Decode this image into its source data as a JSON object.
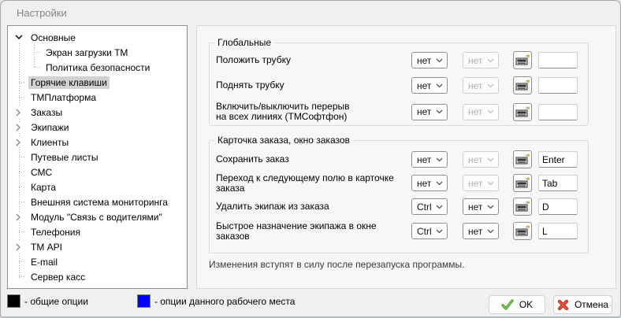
{
  "window": {
    "title": "Настройки",
    "bg_color": "#f0f0f0"
  },
  "tree": {
    "items": [
      {
        "label": "Основные",
        "level": 0,
        "state": "expanded",
        "selected": false
      },
      {
        "label": "Экран загрузки ТМ",
        "level": 1,
        "state": "leaf",
        "selected": false
      },
      {
        "label": "Политика безопасности",
        "level": 1,
        "state": "leaf",
        "selected": false
      },
      {
        "label": "Горячие клавиши",
        "level": 0,
        "state": "leaf",
        "selected": true
      },
      {
        "label": "ТМПлатформа",
        "level": 0,
        "state": "leaf",
        "selected": false
      },
      {
        "label": "Заказы",
        "level": 0,
        "state": "collapsed",
        "selected": false
      },
      {
        "label": "Экипажи",
        "level": 0,
        "state": "collapsed",
        "selected": false
      },
      {
        "label": "Клиенты",
        "level": 0,
        "state": "collapsed",
        "selected": false
      },
      {
        "label": "Путевые листы",
        "level": 0,
        "state": "leaf",
        "selected": false
      },
      {
        "label": "СМС",
        "level": 0,
        "state": "leaf",
        "selected": false
      },
      {
        "label": "Карта",
        "level": 0,
        "state": "leaf",
        "selected": false
      },
      {
        "label": "Внешняя система мониторинга",
        "level": 0,
        "state": "leaf",
        "selected": false
      },
      {
        "label": "Модуль \"Связь с водителями\"",
        "level": 0,
        "state": "collapsed",
        "selected": false
      },
      {
        "label": "Телефония",
        "level": 0,
        "state": "leaf",
        "selected": false
      },
      {
        "label": "ТМ API",
        "level": 0,
        "state": "collapsed",
        "selected": false
      },
      {
        "label": "E-mail",
        "level": 0,
        "state": "leaf",
        "selected": false
      },
      {
        "label": "Сервер касс",
        "level": 0,
        "state": "leaf",
        "selected": false
      }
    ]
  },
  "groups": [
    {
      "title": "Глобальные",
      "rows": [
        {
          "label": "Положить трубку",
          "label2": "",
          "mod1": "нет",
          "mod2": "нет",
          "mod2_enabled": false,
          "key": ""
        },
        {
          "label": "Поднять трубку",
          "label2": "",
          "mod1": "нет",
          "mod2": "нет",
          "mod2_enabled": false,
          "key": ""
        },
        {
          "label": "Включить/выключить перерыв",
          "label2": "на всех линиях (ТМСофтфон)",
          "mod1": "нет",
          "mod2": "нет",
          "mod2_enabled": false,
          "key": ""
        }
      ]
    },
    {
      "title": "Карточка заказа, окно заказов",
      "rows": [
        {
          "label": "Сохранить заказ",
          "label2": "",
          "mod1": "нет",
          "mod2": "нет",
          "mod2_enabled": false,
          "key": "Enter"
        },
        {
          "label": "Переход к следующему полю в карточке заказа",
          "label2": "",
          "mod1": "нет",
          "mod2": "нет",
          "mod2_enabled": false,
          "key": "Tab"
        },
        {
          "label": "Удалить экипаж из заказа",
          "label2": "",
          "mod1": "Ctrl",
          "mod2": "нет",
          "mod2_enabled": true,
          "key": "D"
        },
        {
          "label": "Быстрое назначение экипажа в окне заказов",
          "label2": "",
          "mod1": "Ctrl",
          "mod2": "нет",
          "mod2_enabled": true,
          "key": "L"
        }
      ]
    }
  ],
  "note": "Изменения вступят в силу после перезапуска программы.",
  "legend": {
    "general": {
      "color": "#000000",
      "label": "- общие опции"
    },
    "workstation": {
      "color": "#0000ff",
      "label": "- опции данного рабочего места"
    }
  },
  "buttons": {
    "ok": "OK",
    "cancel": "Отмена"
  }
}
